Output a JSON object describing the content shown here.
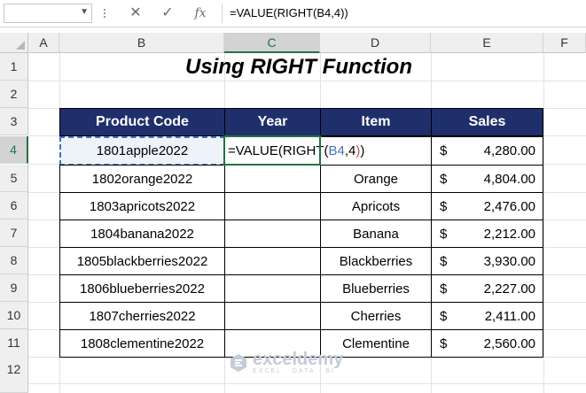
{
  "formula_bar": {
    "name_box": "",
    "cancel_icon": "✕",
    "enter_icon": "✓",
    "fx_label": "fx",
    "formula": "=VALUE(RIGHT(B4,4))"
  },
  "columns": [
    "A",
    "B",
    "C",
    "D",
    "E",
    "F"
  ],
  "rows": [
    "1",
    "2",
    "3",
    "4",
    "5",
    "6",
    "7",
    "8",
    "9",
    "10",
    "11",
    "12"
  ],
  "title": "Using RIGHT Function",
  "table": {
    "headers": [
      "Product Code",
      "Year",
      "Item",
      "Sales"
    ],
    "rows": [
      {
        "code": "1801apple2022",
        "year": "",
        "item": "",
        "currency": "$",
        "sales": "4,280.00"
      },
      {
        "code": "1802orange2022",
        "year": "",
        "item": "Orange",
        "currency": "$",
        "sales": "4,804.00"
      },
      {
        "code": "1803apricots2022",
        "year": "",
        "item": "Apricots",
        "currency": "$",
        "sales": "2,476.00"
      },
      {
        "code": "1804banana2022",
        "year": "",
        "item": "Banana",
        "currency": "$",
        "sales": "2,212.00"
      },
      {
        "code": "1805blackberries2022",
        "year": "",
        "item": "Blackberries",
        "currency": "$",
        "sales": "3,930.00"
      },
      {
        "code": "1806blueberries2022",
        "year": "",
        "item": "Blueberries",
        "currency": "$",
        "sales": "2,227.00"
      },
      {
        "code": "1807cherries2022",
        "year": "",
        "item": "Cherries",
        "currency": "$",
        "sales": "2,411.00"
      },
      {
        "code": "1808clementine2022",
        "year": "",
        "item": "Clementine",
        "currency": "$",
        "sales": "2,560.00"
      }
    ]
  },
  "editing_cell": {
    "prefix": "=VALUE(RIGHT(",
    "ref": "B4",
    "suffix_num": ",4",
    "close1": ")",
    "close2": ")"
  },
  "watermark": {
    "name": "exceldemy",
    "tagline": "EXCEL · DATA · BI"
  },
  "colors": {
    "header_fill": "#1f2f6b",
    "selection_green": "#217346",
    "reference_blue": "#4472c4"
  }
}
